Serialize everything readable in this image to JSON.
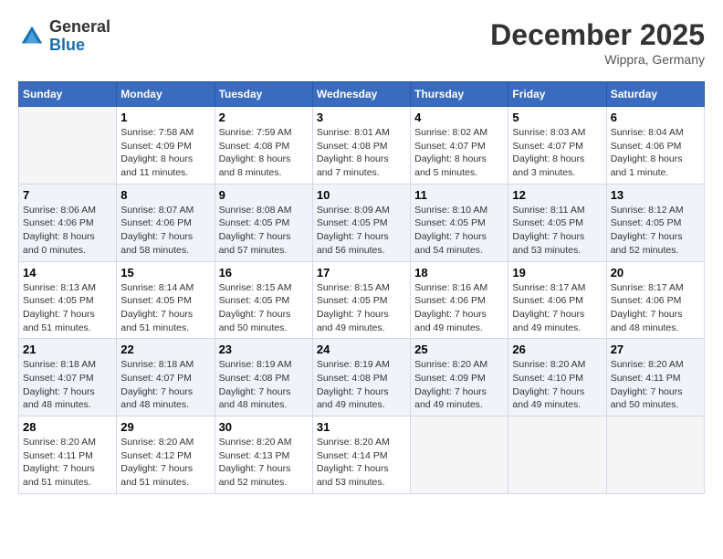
{
  "header": {
    "logo": {
      "general": "General",
      "blue": "Blue"
    },
    "title": "December 2025",
    "subtitle": "Wippra, Germany"
  },
  "weekdays": [
    "Sunday",
    "Monday",
    "Tuesday",
    "Wednesday",
    "Thursday",
    "Friday",
    "Saturday"
  ],
  "weeks": [
    [
      {
        "day": "",
        "empty": true
      },
      {
        "day": "1",
        "sunrise": "Sunrise: 7:58 AM",
        "sunset": "Sunset: 4:09 PM",
        "daylight": "Daylight: 8 hours and 11 minutes."
      },
      {
        "day": "2",
        "sunrise": "Sunrise: 7:59 AM",
        "sunset": "Sunset: 4:08 PM",
        "daylight": "Daylight: 8 hours and 8 minutes."
      },
      {
        "day": "3",
        "sunrise": "Sunrise: 8:01 AM",
        "sunset": "Sunset: 4:08 PM",
        "daylight": "Daylight: 8 hours and 7 minutes."
      },
      {
        "day": "4",
        "sunrise": "Sunrise: 8:02 AM",
        "sunset": "Sunset: 4:07 PM",
        "daylight": "Daylight: 8 hours and 5 minutes."
      },
      {
        "day": "5",
        "sunrise": "Sunrise: 8:03 AM",
        "sunset": "Sunset: 4:07 PM",
        "daylight": "Daylight: 8 hours and 3 minutes."
      },
      {
        "day": "6",
        "sunrise": "Sunrise: 8:04 AM",
        "sunset": "Sunset: 4:06 PM",
        "daylight": "Daylight: 8 hours and 1 minute."
      }
    ],
    [
      {
        "day": "7",
        "sunrise": "Sunrise: 8:06 AM",
        "sunset": "Sunset: 4:06 PM",
        "daylight": "Daylight: 8 hours and 0 minutes."
      },
      {
        "day": "8",
        "sunrise": "Sunrise: 8:07 AM",
        "sunset": "Sunset: 4:06 PM",
        "daylight": "Daylight: 7 hours and 58 minutes."
      },
      {
        "day": "9",
        "sunrise": "Sunrise: 8:08 AM",
        "sunset": "Sunset: 4:05 PM",
        "daylight": "Daylight: 7 hours and 57 minutes."
      },
      {
        "day": "10",
        "sunrise": "Sunrise: 8:09 AM",
        "sunset": "Sunset: 4:05 PM",
        "daylight": "Daylight: 7 hours and 56 minutes."
      },
      {
        "day": "11",
        "sunrise": "Sunrise: 8:10 AM",
        "sunset": "Sunset: 4:05 PM",
        "daylight": "Daylight: 7 hours and 54 minutes."
      },
      {
        "day": "12",
        "sunrise": "Sunrise: 8:11 AM",
        "sunset": "Sunset: 4:05 PM",
        "daylight": "Daylight: 7 hours and 53 minutes."
      },
      {
        "day": "13",
        "sunrise": "Sunrise: 8:12 AM",
        "sunset": "Sunset: 4:05 PM",
        "daylight": "Daylight: 7 hours and 52 minutes."
      }
    ],
    [
      {
        "day": "14",
        "sunrise": "Sunrise: 8:13 AM",
        "sunset": "Sunset: 4:05 PM",
        "daylight": "Daylight: 7 hours and 51 minutes."
      },
      {
        "day": "15",
        "sunrise": "Sunrise: 8:14 AM",
        "sunset": "Sunset: 4:05 PM",
        "daylight": "Daylight: 7 hours and 51 minutes."
      },
      {
        "day": "16",
        "sunrise": "Sunrise: 8:15 AM",
        "sunset": "Sunset: 4:05 PM",
        "daylight": "Daylight: 7 hours and 50 minutes."
      },
      {
        "day": "17",
        "sunrise": "Sunrise: 8:15 AM",
        "sunset": "Sunset: 4:05 PM",
        "daylight": "Daylight: 7 hours and 49 minutes."
      },
      {
        "day": "18",
        "sunrise": "Sunrise: 8:16 AM",
        "sunset": "Sunset: 4:06 PM",
        "daylight": "Daylight: 7 hours and 49 minutes."
      },
      {
        "day": "19",
        "sunrise": "Sunrise: 8:17 AM",
        "sunset": "Sunset: 4:06 PM",
        "daylight": "Daylight: 7 hours and 49 minutes."
      },
      {
        "day": "20",
        "sunrise": "Sunrise: 8:17 AM",
        "sunset": "Sunset: 4:06 PM",
        "daylight": "Daylight: 7 hours and 48 minutes."
      }
    ],
    [
      {
        "day": "21",
        "sunrise": "Sunrise: 8:18 AM",
        "sunset": "Sunset: 4:07 PM",
        "daylight": "Daylight: 7 hours and 48 minutes."
      },
      {
        "day": "22",
        "sunrise": "Sunrise: 8:18 AM",
        "sunset": "Sunset: 4:07 PM",
        "daylight": "Daylight: 7 hours and 48 minutes."
      },
      {
        "day": "23",
        "sunrise": "Sunrise: 8:19 AM",
        "sunset": "Sunset: 4:08 PM",
        "daylight": "Daylight: 7 hours and 48 minutes."
      },
      {
        "day": "24",
        "sunrise": "Sunrise: 8:19 AM",
        "sunset": "Sunset: 4:08 PM",
        "daylight": "Daylight: 7 hours and 49 minutes."
      },
      {
        "day": "25",
        "sunrise": "Sunrise: 8:20 AM",
        "sunset": "Sunset: 4:09 PM",
        "daylight": "Daylight: 7 hours and 49 minutes."
      },
      {
        "day": "26",
        "sunrise": "Sunrise: 8:20 AM",
        "sunset": "Sunset: 4:10 PM",
        "daylight": "Daylight: 7 hours and 49 minutes."
      },
      {
        "day": "27",
        "sunrise": "Sunrise: 8:20 AM",
        "sunset": "Sunset: 4:11 PM",
        "daylight": "Daylight: 7 hours and 50 minutes."
      }
    ],
    [
      {
        "day": "28",
        "sunrise": "Sunrise: 8:20 AM",
        "sunset": "Sunset: 4:11 PM",
        "daylight": "Daylight: 7 hours and 51 minutes."
      },
      {
        "day": "29",
        "sunrise": "Sunrise: 8:20 AM",
        "sunset": "Sunset: 4:12 PM",
        "daylight": "Daylight: 7 hours and 51 minutes."
      },
      {
        "day": "30",
        "sunrise": "Sunrise: 8:20 AM",
        "sunset": "Sunset: 4:13 PM",
        "daylight": "Daylight: 7 hours and 52 minutes."
      },
      {
        "day": "31",
        "sunrise": "Sunrise: 8:20 AM",
        "sunset": "Sunset: 4:14 PM",
        "daylight": "Daylight: 7 hours and 53 minutes."
      },
      {
        "day": "",
        "empty": true
      },
      {
        "day": "",
        "empty": true
      },
      {
        "day": "",
        "empty": true
      }
    ]
  ]
}
